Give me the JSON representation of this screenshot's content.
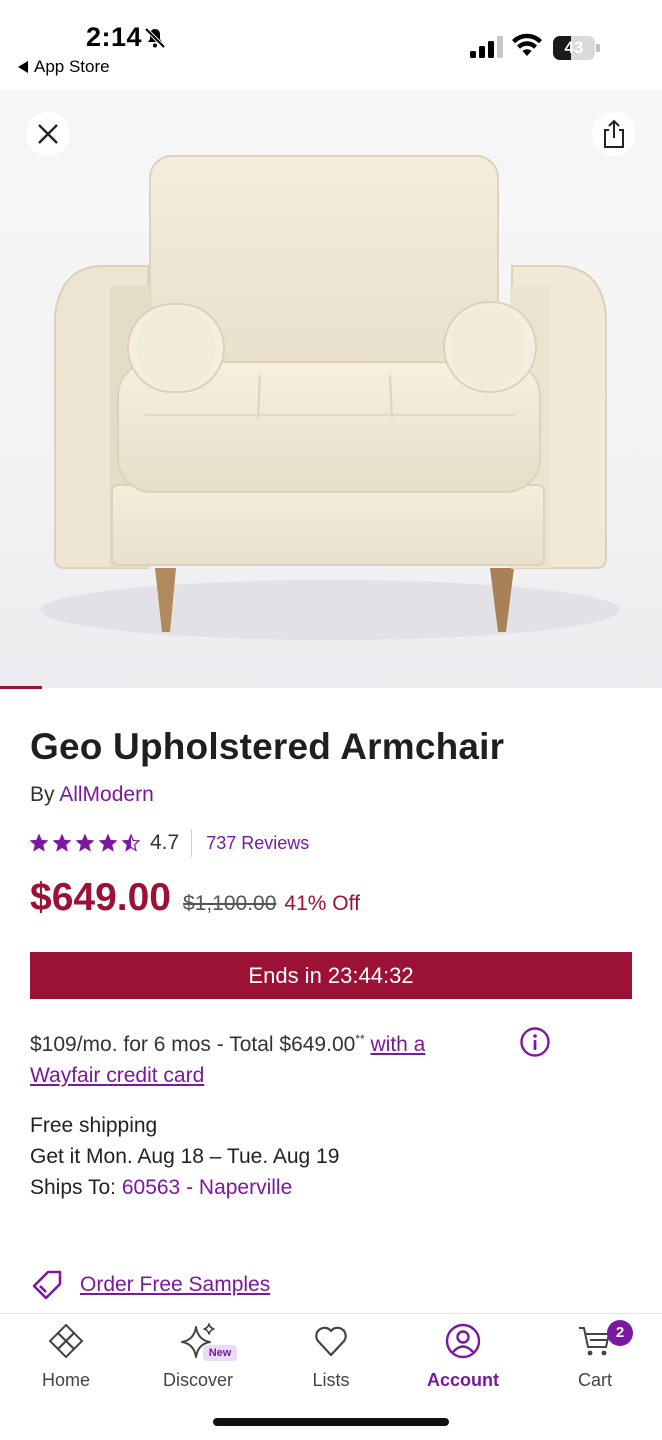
{
  "status_bar": {
    "time": "2:14",
    "back_label": "App Store",
    "battery": "43"
  },
  "product": {
    "title": "Geo Upholstered Armchair",
    "by_prefix": "By",
    "brand": "AllModern",
    "rating": "4.7",
    "rating_stars": 4.5,
    "reviews": "737 Reviews",
    "price": "$649.00",
    "original_price": "$1,100.00",
    "discount": "41% Off",
    "timer": "Ends in 23:44:32"
  },
  "financing": {
    "text": "$109/mo. for 6 mos - Total $649.00",
    "footnote": "**",
    "link_part1": "with a",
    "link_part2": "Wayfair credit card"
  },
  "shipping": {
    "line1": "Free shipping",
    "line2": "Get it Mon. Aug 18 – Tue. Aug 19",
    "ships_to_label": "Ships To:",
    "ships_to_value": "60563 - Naperville"
  },
  "samples": {
    "label": "Order Free Samples"
  },
  "tab_bar": {
    "tabs": [
      {
        "label": "Home",
        "icon": "home-icon"
      },
      {
        "label": "Discover",
        "icon": "sparkle-icon",
        "badge": "New"
      },
      {
        "label": "Lists",
        "icon": "heart-icon"
      },
      {
        "label": "Account",
        "icon": "account-icon",
        "active": true
      },
      {
        "label": "Cart",
        "icon": "cart-icon",
        "badge": "2"
      }
    ]
  },
  "colors": {
    "accent": "#7b189f",
    "sale": "#9b1236",
    "chair": "#efe8d6",
    "legs": "#b08a5e"
  }
}
